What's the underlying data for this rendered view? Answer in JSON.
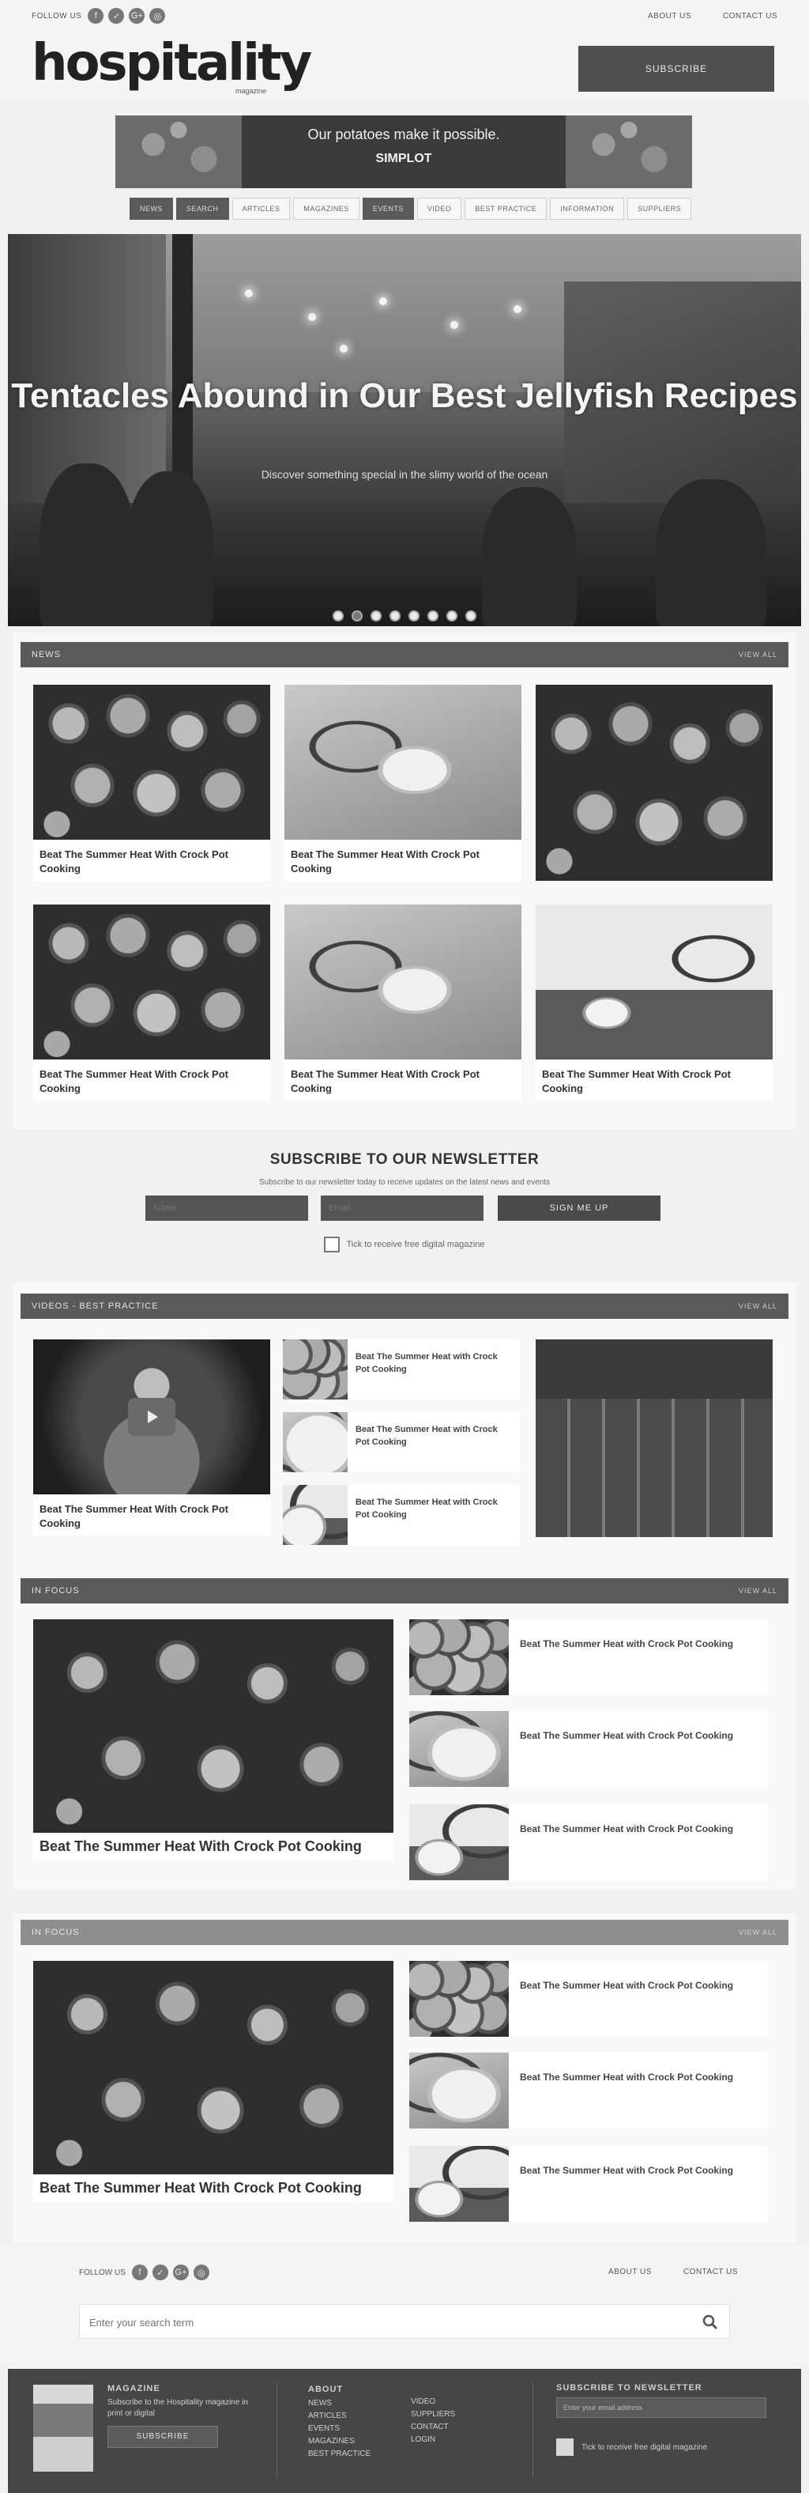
{
  "topbar": {
    "follow": "FOLLOW US",
    "links": [
      "ABOUT US",
      "CONTACT US"
    ]
  },
  "social": [
    "f",
    "✓",
    "G+",
    "◎"
  ],
  "header": {
    "logo": "hospitality",
    "logo_sub": "magazine",
    "subscribe": "SUBSCRIBE"
  },
  "banner": {
    "tagline": "Our potatoes make it possible.",
    "brand": "SIMPLOT"
  },
  "nav": {
    "items": [
      "NEWS",
      "SEARCH",
      "ARTICLES",
      "MAGAZINES",
      "EVENTS",
      "VIDEO",
      "BEST PRACTICE",
      "INFORMATION",
      "SUPPLIERS"
    ]
  },
  "hero": {
    "title": "Tentacles Abound in Our Best Jellyfish Recipes",
    "subtitle": "Discover something special in the slimy world of the ocean",
    "slides": 8
  },
  "news": {
    "bar": "NEWS",
    "more": "VIEW ALL",
    "cards": [
      {
        "caption": "Beat The Summer Heat With Crock Pot Cooking"
      },
      {
        "caption": "Beat The Summer Heat With Crock Pot Cooking"
      },
      {
        "caption": ""
      },
      {
        "caption": "Beat The Summer Heat With Crock Pot Cooking"
      },
      {
        "caption": "Beat The Summer Heat With Crock Pot Cooking"
      },
      {
        "caption": "Beat The Summer Heat With Crock Pot Cooking"
      }
    ]
  },
  "newsletter": {
    "title": "SUBSCRIBE TO OUR NEWSLETTER",
    "sub": "Subscribe to our newsletter today to receive updates on the latest news and events",
    "name_placeholder": "Name",
    "email_placeholder": "Email",
    "button": "SIGN ME UP",
    "check_label": "Tick to receive free digital magazine"
  },
  "video": {
    "bar": "VIDEOS - BEST PRACTICE",
    "more": "VIEW ALL",
    "main_caption": "Beat The Summer Heat With Crock Pot Cooking",
    "list": [
      "Beat The Summer Heat with Crock Pot Cooking",
      "Beat The Summer Heat with Crock Pot Cooking",
      "Beat The Summer Heat with Crock Pot Cooking"
    ]
  },
  "infocus1": {
    "bar": "IN FOCUS",
    "more": "VIEW ALL",
    "main_caption": "Beat The Summer Heat With Crock Pot Cooking",
    "list": [
      "Beat The Summer Heat with Crock Pot Cooking",
      "Beat The Summer Heat with Crock Pot Cooking",
      "Beat The Summer Heat with Crock Pot Cooking"
    ]
  },
  "infocus2": {
    "bar": "IN FOCUS",
    "more": "VIEW ALL",
    "main_caption": "Beat The Summer Heat With Crock Pot Cooking",
    "list": [
      "Beat The Summer Heat with Crock Pot Cooking",
      "Beat The Summer Heat with Crock Pot Cooking",
      "Beat The Summer Heat with Crock Pot Cooking"
    ]
  },
  "footer_top": {
    "follow": "FOLLOW US",
    "links": [
      "ABOUT US",
      "CONTACT US"
    ],
    "search_placeholder": "Enter your search term"
  },
  "footer": {
    "mag_heading": "MAGAZINE",
    "mag_text": "Subscribe to the Hospitality magazine in print or digital",
    "mag_button": "SUBSCRIBE",
    "nav_heading": "ABOUT",
    "nav_col1": [
      "NEWS",
      "ARTICLES",
      "EVENTS",
      "MAGAZINES",
      "BEST PRACTICE"
    ],
    "nav_col2": [
      "VIDEO",
      "SUPPLIERS",
      "CONTACT",
      "LOGIN"
    ],
    "nl_heading": "SUBSCRIBE TO NEWSLETTER",
    "nl_placeholder": "Enter your email address",
    "nl_check": "Tick to receive free digital magazine"
  }
}
